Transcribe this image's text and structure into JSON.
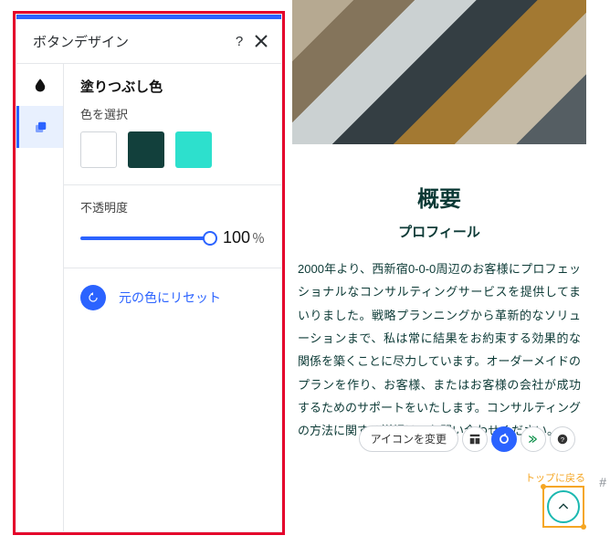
{
  "panel": {
    "title": "ボタンデザイン",
    "help": "?",
    "fill": {
      "heading": "塗りつぶし色",
      "pick_label": "色を選択",
      "swatches": [
        {
          "color": "#ffffff",
          "cls": "white"
        },
        {
          "color": "#12403c",
          "cls": ""
        },
        {
          "color": "#2de0cd",
          "cls": ""
        }
      ],
      "opacity_label": "不透明度",
      "opacity_value": "100",
      "opacity_unit": "％",
      "reset_label": "元の色にリセット"
    }
  },
  "preview": {
    "h1": "概要",
    "h2": "プロフィール",
    "body": "2000年より、西新宿0-0-0周辺のお客様にプロフェッショナルなコンサルティングサービスを提供してまいりました。戦略プランニングから革新的なソリューションまで、私は常に結果をお約束する効果的な関係を築くことに尽力しています。オーダーメイドのプランを作り、お客様、またはお客様の会社が成功するためのサポートをいたします。コンサルティングの方法に関する詳細は、お問い合わせください。"
  },
  "toolbar": {
    "change_icon": "アイコンを変更"
  },
  "back_to_top": "トップに戻る",
  "off_hash": "#"
}
